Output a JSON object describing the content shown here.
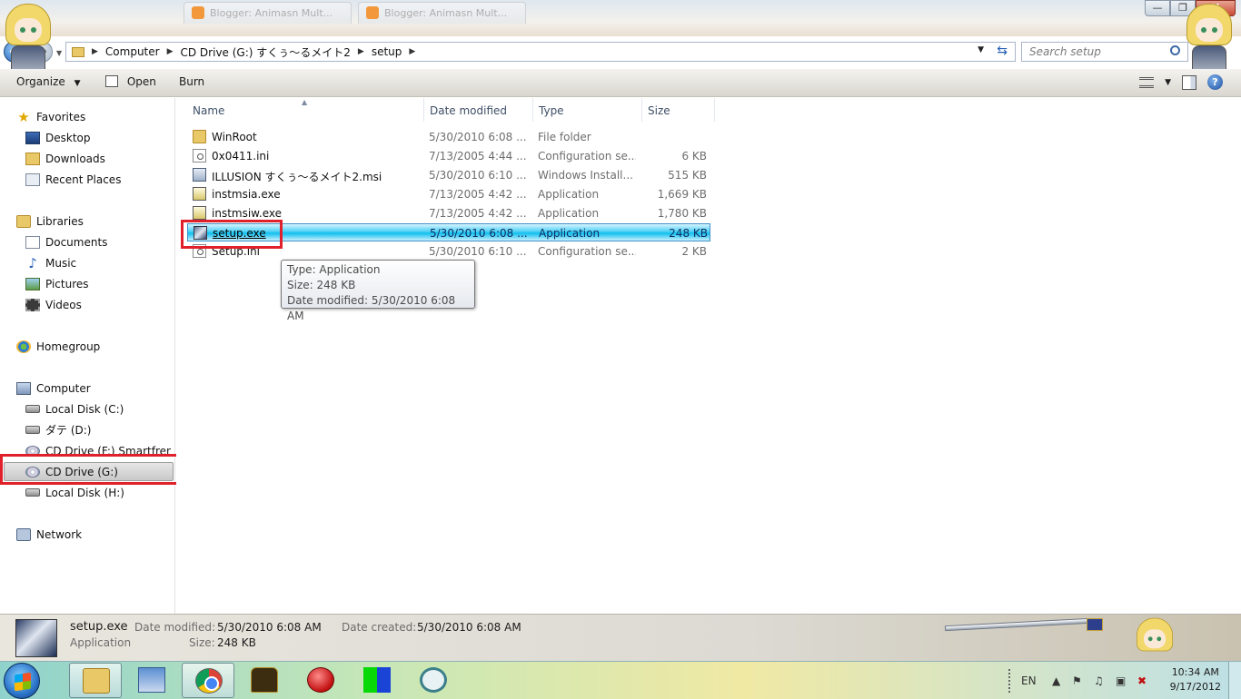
{
  "browser": {
    "tabs": [
      "Blogger: Animasn Mult...",
      "Blogger: Animasn Mult..."
    ]
  },
  "window": {
    "minimize": "—",
    "maximize": "❐",
    "close": "X"
  },
  "address": {
    "crumbs": [
      "Computer",
      "CD Drive (G:) すくぅ～るメイト2",
      "setup"
    ],
    "search_placeholder": "Search setup"
  },
  "toolbar": {
    "organize": "Organize",
    "open": "Open",
    "burn": "Burn"
  },
  "nav": {
    "favorites": "Favorites",
    "desktop": "Desktop",
    "downloads": "Downloads",
    "recent_places": "Recent Places",
    "libraries": "Libraries",
    "documents": "Documents",
    "music": "Music",
    "pictures": "Pictures",
    "videos": "Videos",
    "homegroup": "Homegroup",
    "computer": "Computer",
    "local_c": "Local Disk (C:)",
    "date_d": "ダテ (D:)",
    "cd_f": "CD Drive (F:) Smartfren",
    "cd_g": "CD Drive (G:)",
    "local_h": "Local Disk (H:)",
    "network": "Network"
  },
  "columns": {
    "name": "Name",
    "date": "Date modified",
    "type": "Type",
    "size": "Size"
  },
  "files": [
    {
      "name": "WinRoot",
      "date": "5/30/2010 6:08 ...",
      "type": "File folder",
      "size": "",
      "icon": "folder-icon"
    },
    {
      "name": "0x0411.ini",
      "date": "7/13/2005 4:44 ...",
      "type": "Configuration se...",
      "size": "6 KB",
      "icon": "ini-file-icon"
    },
    {
      "name": "ILLUSION すくぅ～るメイト2.msi",
      "date": "5/30/2010 6:10 ...",
      "type": "Windows Install...",
      "size": "515 KB",
      "icon": "msi-file-icon"
    },
    {
      "name": "instmsia.exe",
      "date": "7/13/2005 4:42 ...",
      "type": "Application",
      "size": "1,669 KB",
      "icon": "exe-file-icon"
    },
    {
      "name": "instmsiw.exe",
      "date": "7/13/2005 4:42 ...",
      "type": "Application",
      "size": "1,780 KB",
      "icon": "exe-file-icon"
    },
    {
      "name": "setup.exe",
      "date": "5/30/2010 6:08 ...",
      "type": "Application",
      "size": "248 KB",
      "icon": "setup-exe-icon"
    },
    {
      "name": "Setup.ini",
      "date": "5/30/2010 6:10 ...",
      "type": "Configuration se...",
      "size": "2 KB",
      "icon": "ini-file-icon"
    }
  ],
  "tooltip": {
    "type": "Type: Application",
    "size": "Size: 248 KB",
    "date": "Date modified: 5/30/2010 6:08 AM"
  },
  "details": {
    "filename": "setup.exe",
    "filetype": "Application",
    "date_modified_label": "Date modified:",
    "date_modified": "5/30/2010 6:08 AM",
    "date_created_label": "Date created:",
    "date_created": "5/30/2010 6:08 AM",
    "size_label": "Size:",
    "size": "248 KB"
  },
  "taskbar": {
    "tray_lang": "EN",
    "time": "10:34 AM",
    "date": "9/17/2012"
  }
}
